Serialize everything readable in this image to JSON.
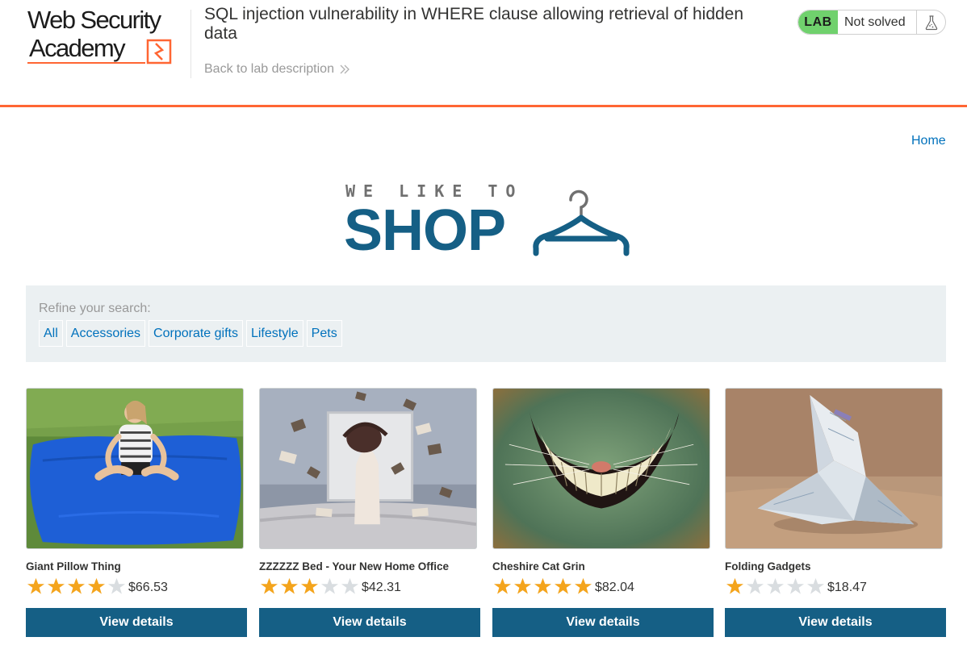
{
  "header": {
    "logo_line1": "Web Security",
    "logo_line2": "Academy",
    "lab_title": "SQL injection vulnerability in WHERE clause allowing retrieval of hidden data",
    "back_link": "Back to lab description",
    "lab_badge": "LAB",
    "lab_status": "Not solved",
    "accent_color": "#ff6633"
  },
  "nav": {
    "home": "Home"
  },
  "banner": {
    "small": "WE LIKE TO",
    "big": "SHOP",
    "color": "#155f85"
  },
  "filter": {
    "label": "Refine your search:",
    "tags": [
      "All",
      "Accessories",
      "Corporate gifts",
      "Lifestyle",
      "Pets"
    ]
  },
  "products": [
    {
      "name": "Giant Pillow Thing",
      "rating": 4,
      "price": "$66.53",
      "button": "View details",
      "image": "girl-on-blue-bean-bag"
    },
    {
      "name": "ZZZZZZ Bed - Your New Home Office",
      "rating": 3,
      "price": "$42.31",
      "button": "View details",
      "image": "woman-in-bed-flying-books"
    },
    {
      "name": "Cheshire Cat Grin",
      "rating": 5,
      "price": "$82.04",
      "button": "View details",
      "image": "cheshire-cat-smile"
    },
    {
      "name": "Folding Gadgets",
      "rating": 1,
      "price": "$18.47",
      "button": "View details",
      "image": "origami-banknote"
    }
  ],
  "colors": {
    "star_filled": "#f4a41c",
    "star_empty": "#d9dde0",
    "button": "#155f85",
    "link": "#0071bc",
    "lab_badge": "#70d16d"
  }
}
